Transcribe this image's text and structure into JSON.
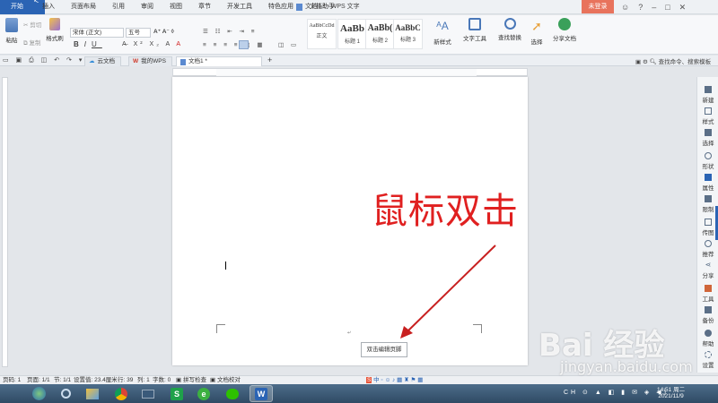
{
  "titlebar": {
    "app_name": "WPS 文字",
    "doc_title": "文档1 * - WPS 文字",
    "login": "未登录",
    "menu": [
      "开始",
      "插入",
      "页面布局",
      "引用",
      "审阅",
      "视图",
      "章节",
      "开发工具",
      "特色应用",
      "文档助手"
    ]
  },
  "ribbon": {
    "paste": "粘贴",
    "cut": "剪切",
    "copy": "复制",
    "format_painter": "格式刷",
    "font": "宋体 (正文)",
    "size": "五号",
    "styles": [
      {
        "sample": "AaBbCcDd",
        "label": "正文"
      },
      {
        "sample": "AaBb",
        "label": "标题 1"
      },
      {
        "sample": "AaBb(",
        "label": "标题 2"
      },
      {
        "sample": "AaBbC",
        "label": "标题 3"
      }
    ],
    "new_style": "新样式",
    "text_tools": "文字工具",
    "find_replace": "查找替换",
    "select": "选择",
    "share_doc": "分享文档"
  },
  "tabs": [
    {
      "label": "云文档"
    },
    {
      "label": "我的WPS"
    },
    {
      "label": "文档1 *"
    }
  ],
  "tabstrip": {
    "search": "查找命令、搜索模板"
  },
  "document": {
    "annotation": "鼠标双击",
    "footer_tip": "双击编辑页脚"
  },
  "rightbar": [
    "新建",
    "样式",
    "选择",
    "形状",
    "属性",
    "限制",
    "传图",
    "推荐",
    "分享",
    "工具",
    "备份",
    "帮助",
    "设置"
  ],
  "status": {
    "page": "页码: 1",
    "pages": "页面: 1/1",
    "section": "节: 1/1",
    "setting": "设置值: 23.4厘米",
    "row": "行: 39",
    "col": "列: 1",
    "words": "字数: 0",
    "spell": "拼写检查",
    "proof": "文档校对"
  },
  "taskbar": {
    "time": "14:51 周二",
    "date": "2021/11/9"
  },
  "watermark": {
    "brand": "Bai 经验",
    "url": "jingyan.baidu.com"
  },
  "colors": {
    "accent": "#2b64b4",
    "login": "#e8735c",
    "annotation": "#e02020"
  }
}
